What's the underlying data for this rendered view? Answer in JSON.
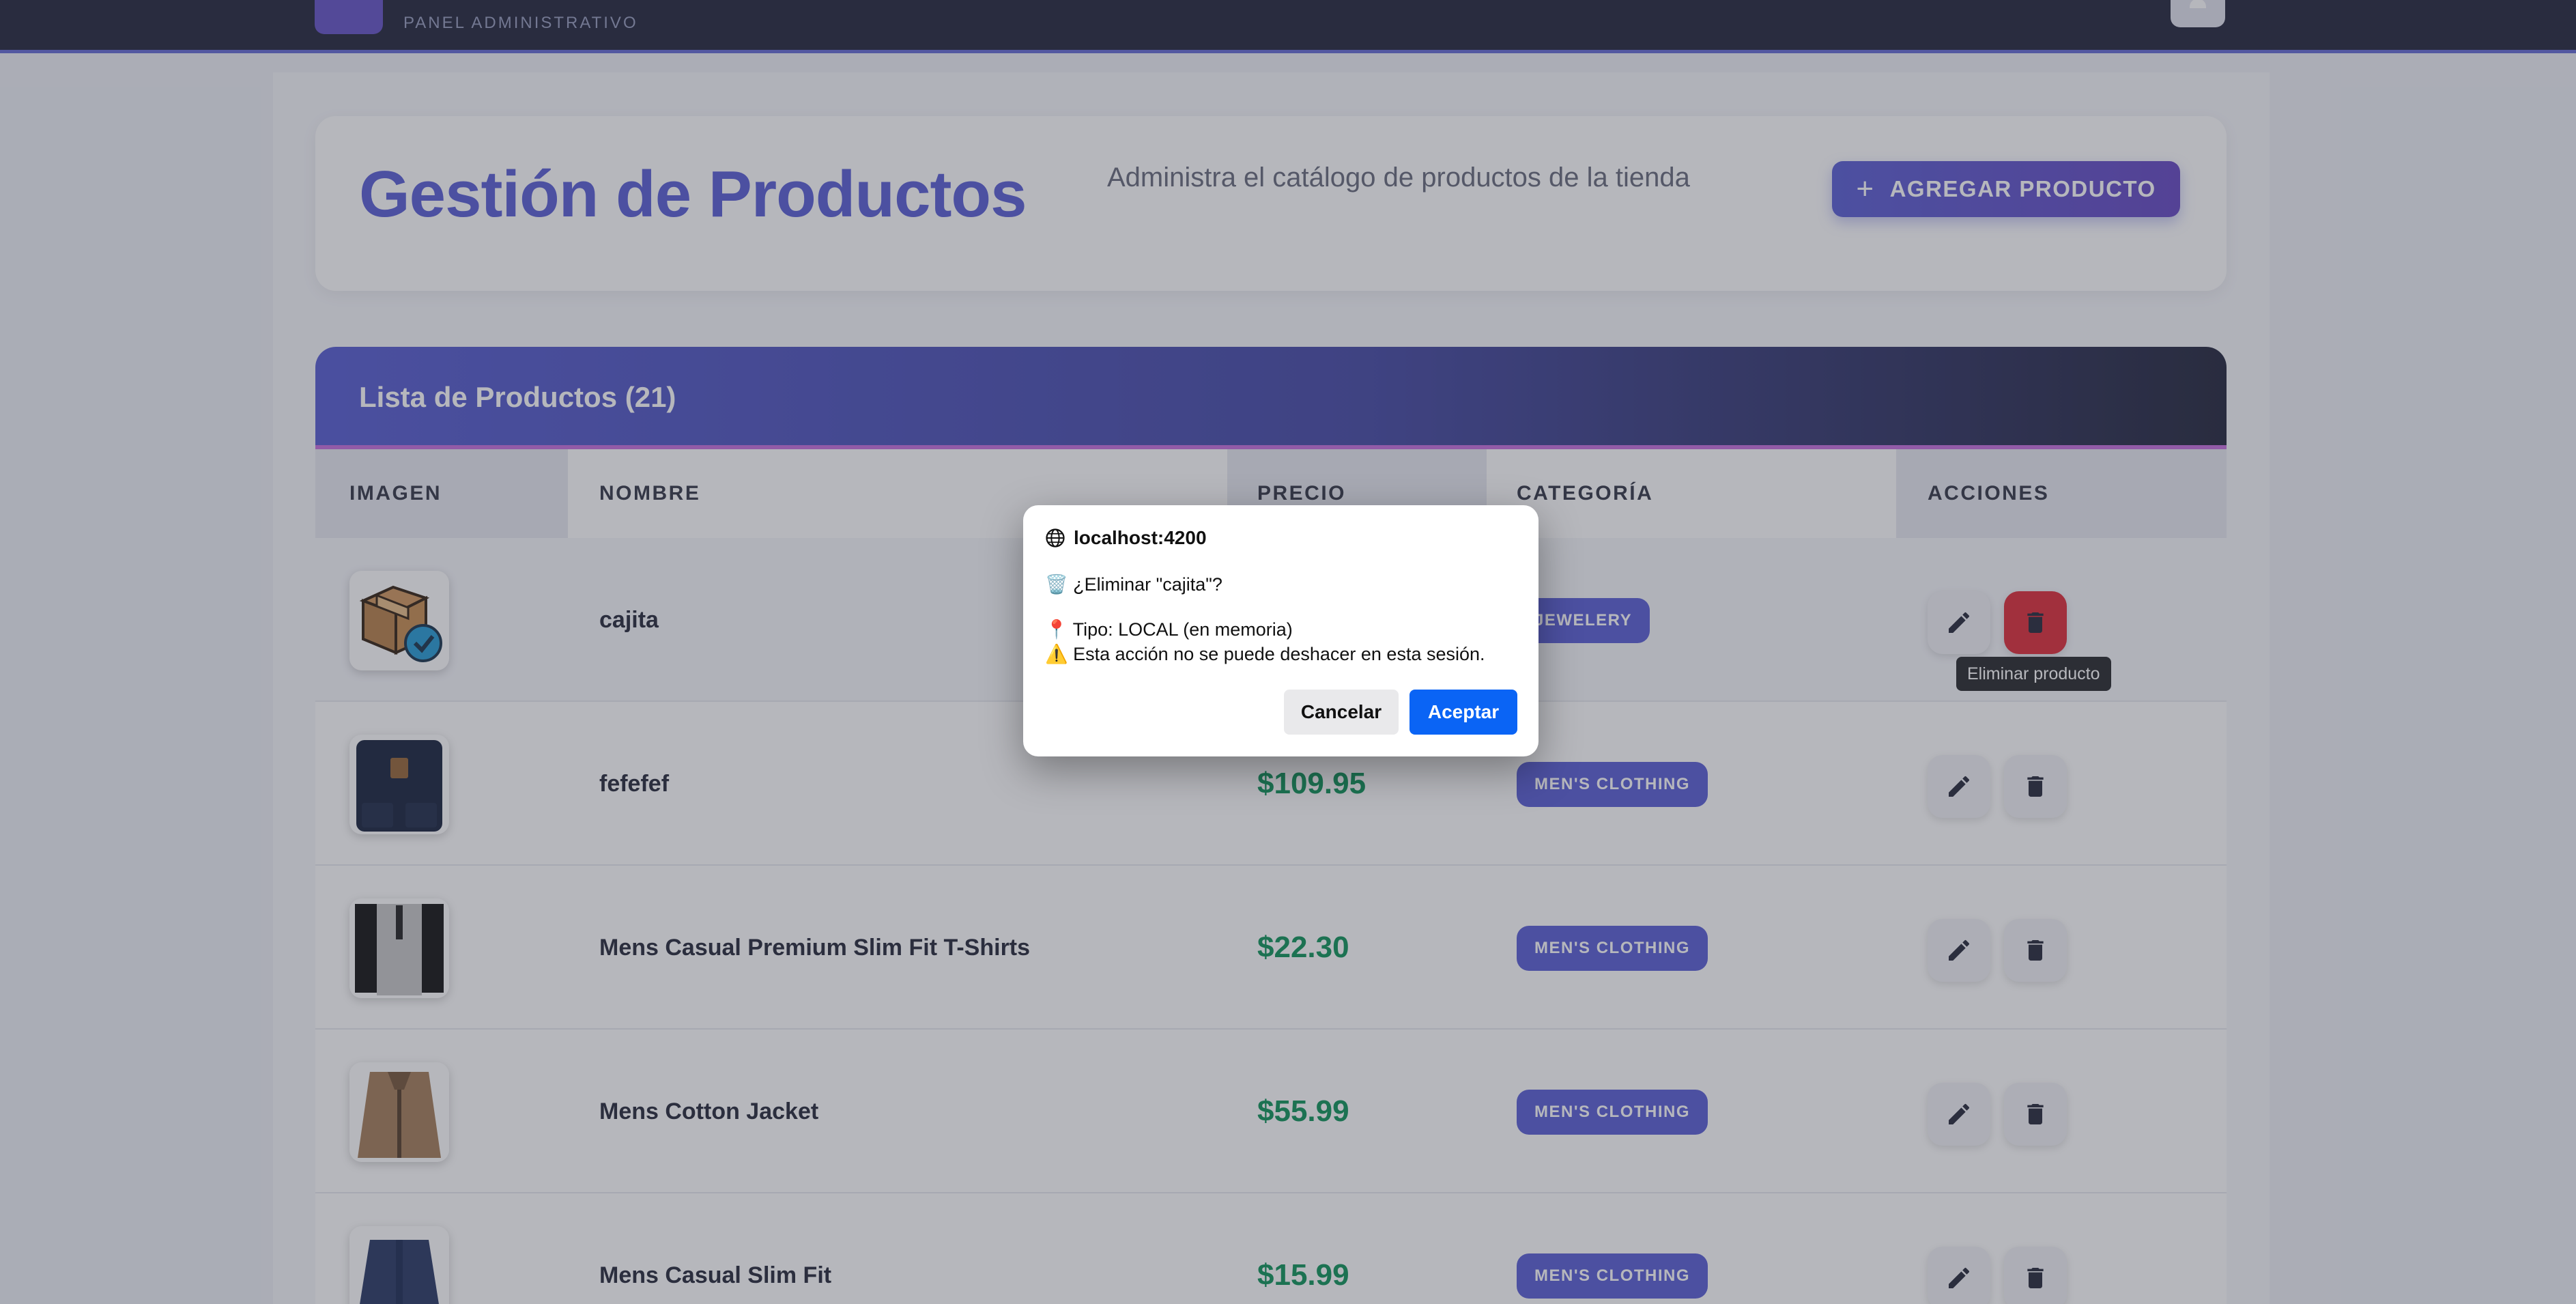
{
  "topbar": {
    "panel_label": "PANEL ADMINISTRATIVO"
  },
  "header": {
    "title": "Gestión de Productos",
    "subtitle": "Administra el catálogo de productos de la tienda",
    "add_button_label": "AGREGAR PRODUCTO",
    "add_button_icon": "plus-icon"
  },
  "list": {
    "title": "Lista de Productos (21)",
    "columns": [
      "IMAGEN",
      "NOMBRE",
      "PRECIO",
      "CATEGORÍA",
      "ACCIONES"
    ],
    "rows": [
      {
        "name": "cajita",
        "price": "",
        "category": "JEWELERY"
      },
      {
        "name": "fefefef",
        "price": "$109.95",
        "category": "MEN'S CLOTHING"
      },
      {
        "name": "Mens Casual Premium Slim Fit T-Shirts",
        "price": "$22.30",
        "category": "MEN'S CLOTHING"
      },
      {
        "name": "Mens Cotton Jacket",
        "price": "$55.99",
        "category": "MEN'S CLOTHING"
      },
      {
        "name": "Mens Casual Slim Fit",
        "price": "$15.99",
        "category": "MEN'S CLOTHING"
      }
    ],
    "tooltip": "Eliminar producto"
  },
  "dialog": {
    "origin": "localhost:4200",
    "question": "🗑️ ¿Eliminar \"cajita\"?",
    "type_line": "📍 Tipo: LOCAL (en memoria)",
    "warning_line": "⚠️ Esta acción no se puede deshacer en esta sesión.",
    "cancel_label": "Cancelar",
    "ok_label": "Aceptar"
  },
  "colors": {
    "accent": "#5f63d6",
    "price_green": "#16965e",
    "danger": "#e0323f",
    "dialog_primary": "#0a64f5"
  }
}
